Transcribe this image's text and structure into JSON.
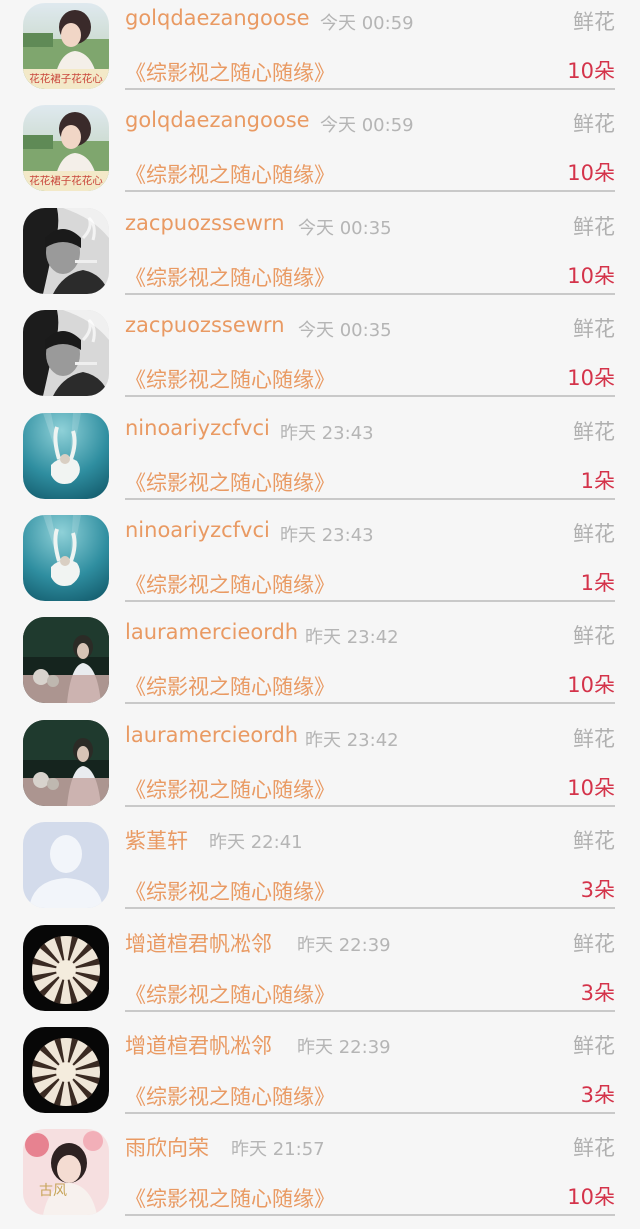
{
  "gift_records": [
    {
      "username": "golqdaezangoose",
      "time": "今天 00:59",
      "gift_type": "鲜花",
      "book_title": "《综影视之随心随缘》",
      "amount": "10朵",
      "avatar": "girl-park-avatar",
      "avatar_caption": "花花裙子花花心"
    },
    {
      "username": "golqdaezangoose",
      "time": "今天 00:59",
      "gift_type": "鲜花",
      "book_title": "《综影视之随心随缘》",
      "amount": "10朵",
      "avatar": "girl-park-avatar",
      "avatar_caption": "花花裙子花花心"
    },
    {
      "username": "zacpuozssewrn",
      "time": "今天 00:35",
      "gift_type": "鲜花",
      "book_title": "《综影视之随心随缘》",
      "amount": "10朵",
      "avatar": "smoking-man-avatar"
    },
    {
      "username": "zacpuozssewrn",
      "time": "今天 00:35",
      "gift_type": "鲜花",
      "book_title": "《综影视之随心随缘》",
      "amount": "10朵",
      "avatar": "smoking-man-avatar"
    },
    {
      "username": "ninoariyzcfvci",
      "time": "昨天 23:43",
      "gift_type": "鲜花",
      "book_title": "《综影视之随心随缘》",
      "amount": "1朵",
      "avatar": "underwater-avatar"
    },
    {
      "username": "ninoariyzcfvci",
      "time": "昨天 23:43",
      "gift_type": "鲜花",
      "book_title": "《综影视之随心随缘》",
      "amount": "1朵",
      "avatar": "underwater-avatar"
    },
    {
      "username": "lauramercieordh",
      "time": "昨天 23:42",
      "gift_type": "鲜花",
      "book_title": "《综影视之随心随缘》",
      "amount": "10朵",
      "avatar": "dark-scene-avatar"
    },
    {
      "username": "lauramercieordh",
      "time": "昨天 23:42",
      "gift_type": "鲜花",
      "book_title": "《综影视之随心随缘》",
      "amount": "10朵",
      "avatar": "dark-scene-avatar"
    },
    {
      "username": "紫堇轩",
      "time": "昨天 22:41",
      "gift_type": "鲜花",
      "book_title": "《综影视之随心随缘》",
      "amount": "3朵",
      "avatar": "default-person-avatar"
    },
    {
      "username": "增道楦君帆凇邻",
      "time": "昨天 22:39",
      "gift_type": "鲜花",
      "book_title": "《综影视之随心随缘》",
      "amount": "3朵",
      "avatar": "spiral-flower-avatar"
    },
    {
      "username": "增道楦君帆凇邻",
      "time": "昨天 22:39",
      "gift_type": "鲜花",
      "book_title": "《综影视之随心随缘》",
      "amount": "3朵",
      "avatar": "spiral-flower-avatar"
    },
    {
      "username": "雨欣向荣",
      "time": "昨天 21:57",
      "gift_type": "鲜花",
      "book_title": "《综影视之随心随缘》",
      "amount": "10朵",
      "avatar": "ancient-style-avatar",
      "avatar_caption": "古风"
    }
  ]
}
